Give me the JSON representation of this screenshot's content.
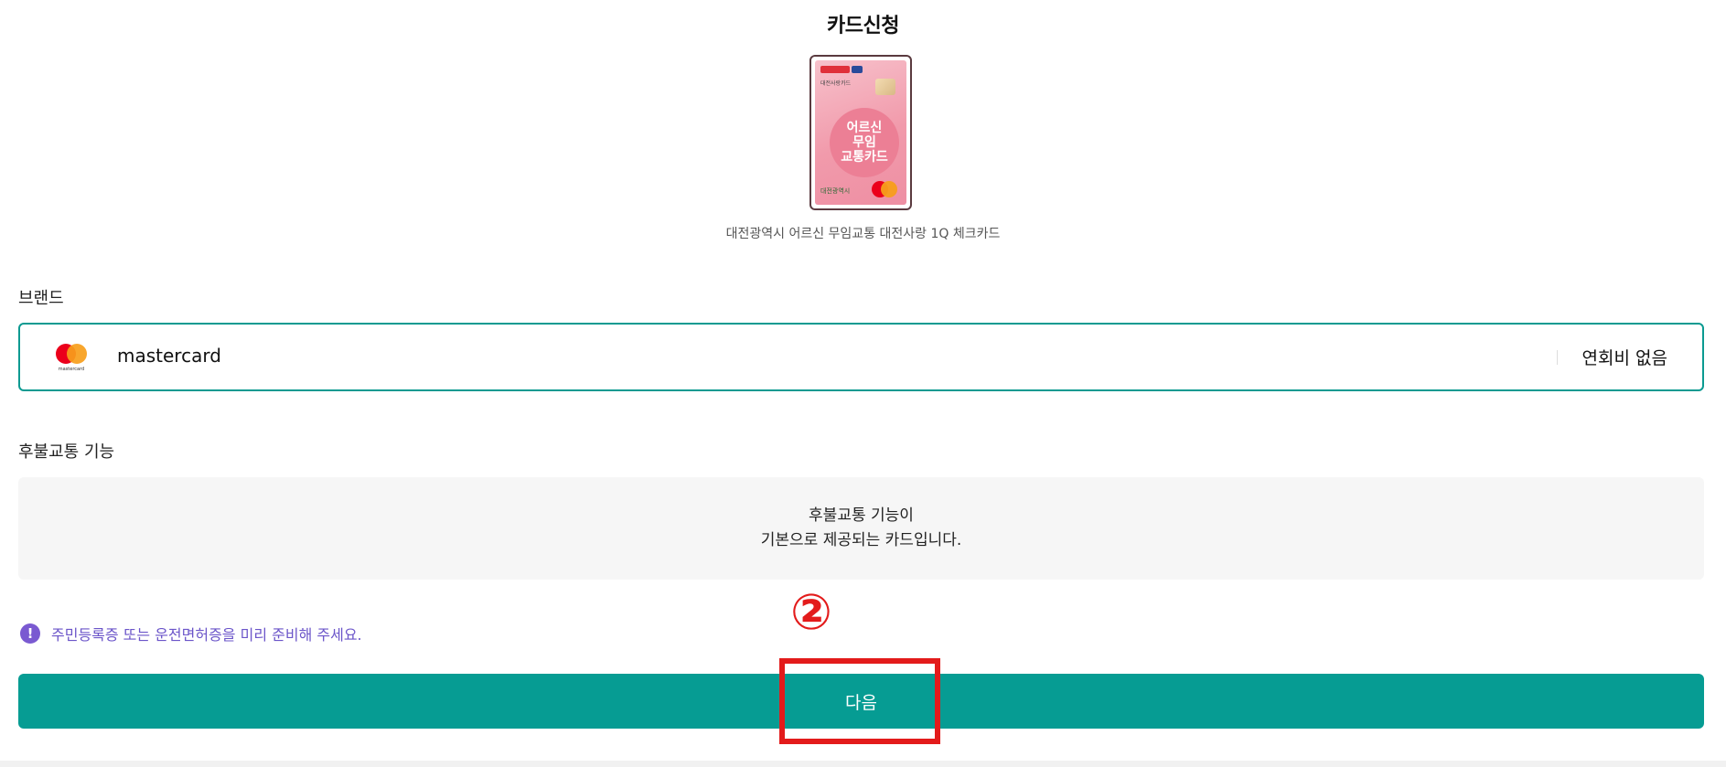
{
  "page": {
    "title": "카드신청"
  },
  "card": {
    "name": "대전광역시 어르신 무임교통 대전사랑 1Q 체크카드",
    "face_text": "어르신\n무임\n교통카드",
    "small_text": "대전사랑카드",
    "city_text": "대전광역시"
  },
  "brand": {
    "label": "브랜드",
    "name": "mastercard",
    "logo_caption": "mastercard",
    "fee": "연회비 없음",
    "border_color": "#0b9a91"
  },
  "postpaid": {
    "label": "후불교통 기능",
    "line1": "후불교통 기능이",
    "line2": "기본으로 제공되는 카드입니다."
  },
  "notice": {
    "icon": "exclamation-icon",
    "icon_glyph": "!",
    "text": "주민등록증 또는 운전면허증을 미리 준비해 주세요."
  },
  "next_button": {
    "label": "다음",
    "color": "#069c93"
  },
  "annotation": {
    "step_marker": "②",
    "color": "#e31b1b"
  }
}
